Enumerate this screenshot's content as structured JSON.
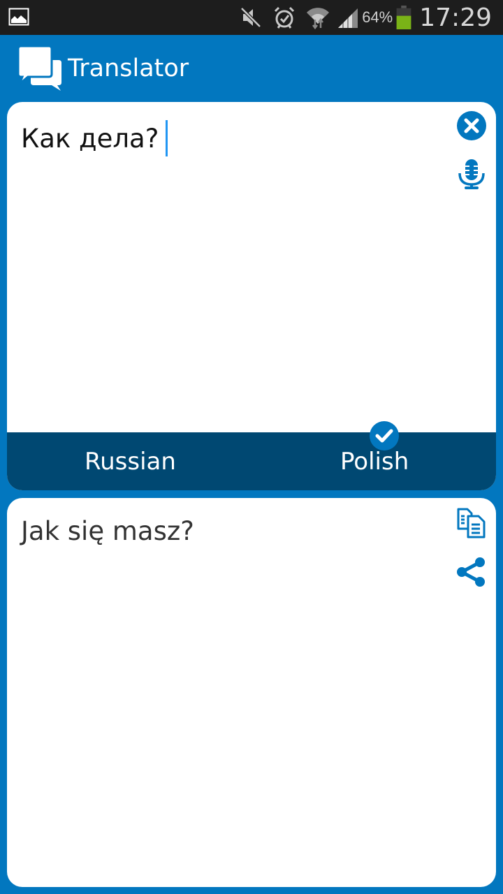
{
  "status_bar": {
    "icons": [
      "gallery-notification-icon",
      "mute-icon",
      "alarm-icon",
      "wifi-icon",
      "signal-icon",
      "battery-icon"
    ],
    "battery_percent": "64%",
    "battery_level": 0.64,
    "time": "17:29"
  },
  "app_bar": {
    "title": "Translator",
    "logo_icon": "chat-bubbles-icon"
  },
  "source": {
    "text": "Как дела?",
    "clear_icon": "clear-circle-icon",
    "mic_icon": "microphone-icon"
  },
  "languages": {
    "source": "Russian",
    "target": "Polish",
    "selected": "target",
    "selected_icon": "check-circle-icon"
  },
  "target": {
    "text": "Jak się masz?",
    "copy_icon": "copy-icon",
    "share_icon": "share-icon"
  },
  "colors": {
    "primary": "#0277bf",
    "language_bar": "#004872",
    "status_bar": "#1d1d1d",
    "caret": "#2196f3",
    "battery": "#7ab317"
  }
}
